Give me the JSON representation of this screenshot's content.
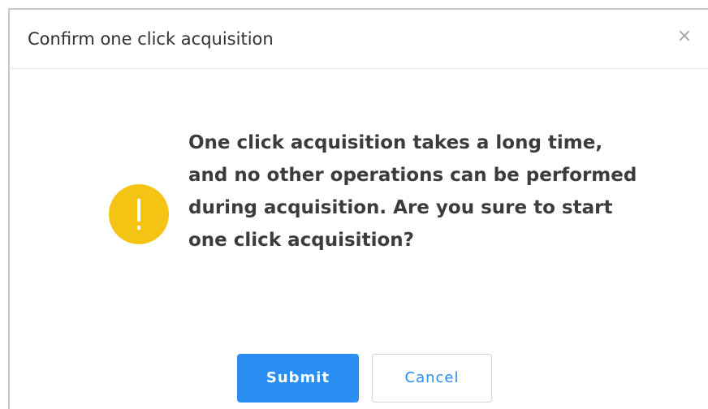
{
  "dialog": {
    "title": "Confirm one click acquisition",
    "close_symbol": "×",
    "icon": "warning-icon",
    "message": "One click acquisition takes a long time, and no other operations can be performed during acquisition. Are you sure to start one click acquisition?",
    "buttons": {
      "submit_label": "Submit",
      "cancel_label": "Cancel"
    }
  },
  "colors": {
    "primary": "#2a8ef2",
    "warning": "#f5c314",
    "text": "#3c3c3c"
  }
}
